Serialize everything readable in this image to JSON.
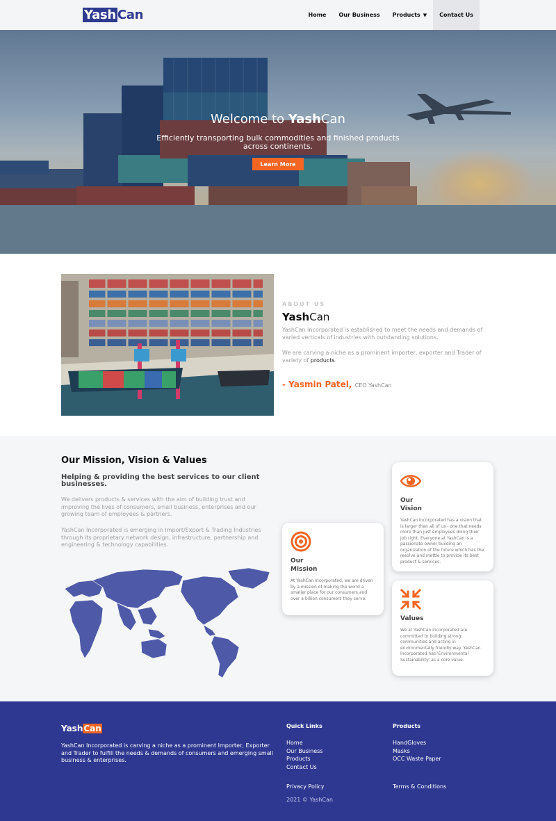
{
  "nav": {
    "logo_a": "Yash",
    "logo_b": "Can",
    "links": [
      {
        "label": "Home"
      },
      {
        "label": "Our Business"
      },
      {
        "label": "Products"
      },
      {
        "label": "Contact Us"
      }
    ]
  },
  "hero": {
    "title_pre": "Welcome to ",
    "title_bold": "Yash",
    "title_post": "Can",
    "subtitle": "Efficiently transporting bulk commodities and finished products across continents.",
    "button": "Learn More"
  },
  "about": {
    "label": "ABOUT US",
    "title_bold": "Yash",
    "title_rest": "Can",
    "p1": "YashCan Incorporated is established to meet the needs and demands of varied verticals of industries with outstanding solutions.",
    "p2": "We are carving a niche as a prominent importer, exporter and Trader of variety of ",
    "p2_link": "products",
    "p2_end": ".",
    "sign_name": "- Yasmin Patel,",
    "sign_role": "CEO YashCan"
  },
  "mission": {
    "title": "Our Mission, Vision & Values",
    "subtitle": "Helping & providing the best services to our client businesses.",
    "p1": "We delivers products & services with the aim of building trust and improving the lives of consumers, small business, enterprises and our growing team of employees & partners.",
    "p2": "YashCan Incorporated is emerging in Import/Export & Trading Industries through its proprietary network design, infrastructure, partnership and engineering & technology capabilities.",
    "cards": [
      {
        "title": "Our Mission",
        "icon": "target-icon",
        "text": "At YashCan Incorporated, we are driven by a mission of making the world a smaller place for our consumers and over a billion consumers they serve."
      },
      {
        "title": "Our Vision",
        "icon": "eye-icon",
        "text": "YashCan Incorporated has a vision that is larger than all of us - one that needs more than just employees doing their job right. Everyone at YashCan is a passionate owner building an organization of the future which has the resolve and mettle to provide its best product & services."
      },
      {
        "title": "Values",
        "icon": "compress-arrows-icon",
        "text": "We at YashCan Incorporated are committed to building strong communities and acting in environmentally friendly way. YashCan Incorporated has 'Environmental Sustainability' as a core value."
      }
    ]
  },
  "footer": {
    "logo_a": "Yash",
    "logo_b": "Can",
    "desc": "YashCan Incorporated is carving a niche as a prominent Importer, Exporter and Trader to fulfill the needs & demands of consumers and emerging small business & enterprises.",
    "quick_title": "Quick Links",
    "quick_links": [
      "Home",
      "Our Business",
      "Products",
      "Contact Us"
    ],
    "products_title": "Products",
    "products": [
      "HandGloves",
      "Masks",
      "OCC Waste Paper"
    ],
    "privacy": "Privacy Policy",
    "terms": "Terms & Conditions",
    "copyright": "2021 © YashCan"
  },
  "colors": {
    "brand_blue": "#2e3891",
    "accent_orange": "#f26522"
  }
}
